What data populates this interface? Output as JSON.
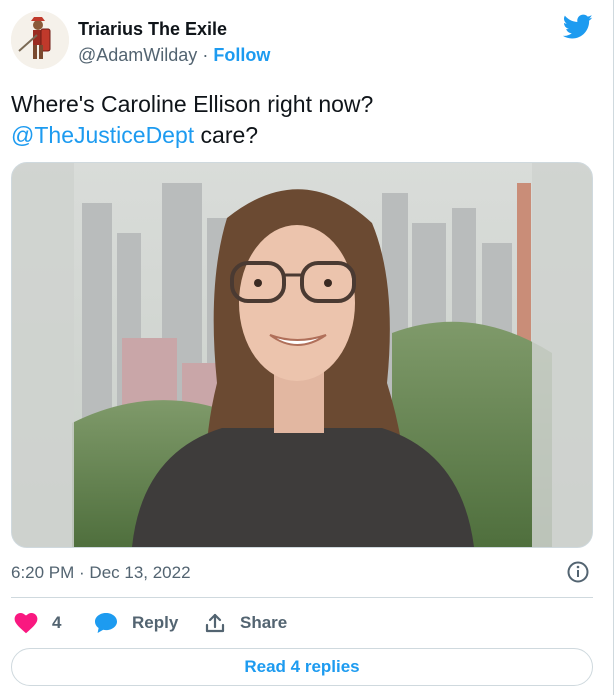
{
  "author": {
    "display_name": "Triarius The Exile",
    "handle": "@AdamWilday",
    "separator": "·",
    "follow_label": "Follow"
  },
  "tweet": {
    "text_line1": "Where's Caroline Ellison right now?",
    "mention": "@TheJusticeDept",
    "text_line2_rest": " care?"
  },
  "timestamp": "6:20 PM · Dec 13, 2022",
  "actions": {
    "like_count": "4",
    "reply_label": "Reply",
    "share_label": "Share"
  },
  "read_replies_label": "Read 4 replies",
  "colors": {
    "accent": "#1d9bf0",
    "like": "#f91880",
    "muted_text": "#536471",
    "border": "#cfd9de"
  },
  "icons": [
    "avatar-image",
    "twitter-bird-icon",
    "info-icon",
    "heart-icon",
    "reply-bubble-icon",
    "share-icon"
  ]
}
